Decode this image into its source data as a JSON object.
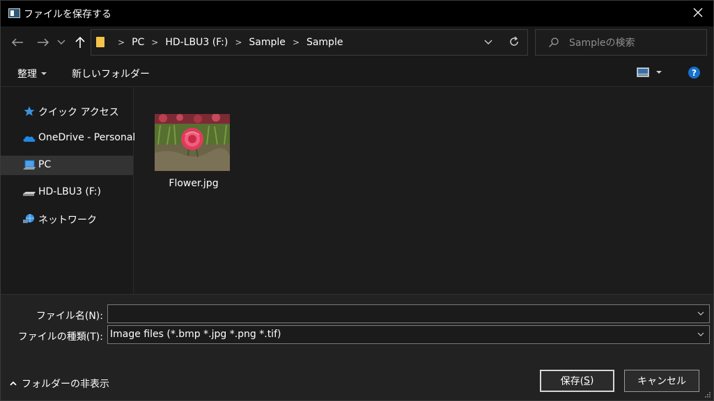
{
  "window": {
    "title": "ファイルを保存する"
  },
  "navigation": {
    "breadcrumbs": [
      "PC",
      "HD-LBU3 (F:)",
      "Sample",
      "Sample"
    ],
    "search_placeholder": "Sampleの検索"
  },
  "toolbar": {
    "organize_label": "整理",
    "new_folder_label": "新しいフォルダー"
  },
  "sidebar": {
    "items": [
      {
        "label": "クイック アクセス",
        "icon": "star-icon"
      },
      {
        "label": "OneDrive - Personal",
        "icon": "cloud-icon"
      },
      {
        "label": "PC",
        "icon": "computer-icon",
        "selected": true
      },
      {
        "label": "HD-LBU3 (F:)",
        "icon": "drive-icon"
      },
      {
        "label": "ネットワーク",
        "icon": "network-icon"
      }
    ]
  },
  "content": {
    "files": [
      {
        "name": "Flower.jpg",
        "icon": "image-thumbnail"
      }
    ]
  },
  "form": {
    "filename_label": "ファイル名(N):",
    "filename_value": "",
    "filetype_label": "ファイルの種類(T):",
    "filetype_value": "Image files (*.bmp *.jpg *.png *.tif)"
  },
  "footer": {
    "hide_folders_label": "フォルダーの非表示",
    "save_label": "保存(",
    "save_mnemonic": "S",
    "save_suffix": ")",
    "cancel_label": "キャンセル"
  },
  "colors": {
    "titlebar": "#000000",
    "background": "#1c1c1c",
    "selected": "#333333",
    "help_icon": "#1570d0",
    "folder_icon": "#f3c44a"
  }
}
